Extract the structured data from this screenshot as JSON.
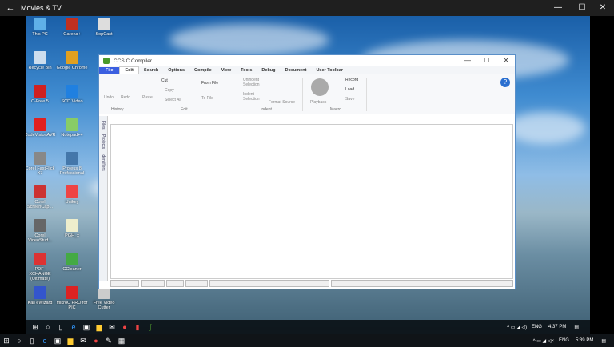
{
  "app": {
    "title": "Movies & TV",
    "back_icon": "arrow-left-icon",
    "min": "—",
    "max": "☐",
    "close": "✕"
  },
  "desktop_icons": [
    {
      "label": "This PC",
      "color": "#5fb0e8"
    },
    {
      "label": "Garena+",
      "color": "#c03020"
    },
    {
      "label": "SopCast",
      "color": "#ddd"
    },
    {
      "label": "Recycle Bin",
      "color": "#cde"
    },
    {
      "label": "Google Chrome",
      "color": "#e0a020"
    },
    {
      "label": "C-Free 5",
      "color": "#d02020"
    },
    {
      "label": "SCD Video",
      "color": "#2080e0"
    },
    {
      "label": "CodeVisionAVR",
      "color": "#e02020"
    },
    {
      "label": "Notepad++",
      "color": "#8c6"
    },
    {
      "label": "Corel FastFlick X7",
      "color": "#888"
    },
    {
      "label": "Proteus 8 Professional",
      "color": "#47a"
    },
    {
      "label": "Corel ScreenCap...",
      "color": "#c33"
    },
    {
      "label": "Unikey",
      "color": "#e44"
    },
    {
      "label": "Corel VideoStud...",
      "color": "#666"
    },
    {
      "label": "PGH_x",
      "color": "#eec"
    },
    {
      "label": "PDF-XCHANGE (Ultimate)",
      "color": "#d33"
    },
    {
      "label": "CCleaner",
      "color": "#4a4"
    },
    {
      "label": "Kali eWizard",
      "color": "#35c"
    },
    {
      "label": "mikroC PRO for PIC",
      "color": "#d22"
    },
    {
      "label": "Free Video Cutter",
      "color": "#ccc"
    }
  ],
  "compiler": {
    "title": "CCS C Compiler",
    "min": "—",
    "max": "☐",
    "close": "✕",
    "menus": [
      "File",
      "Edit",
      "Search",
      "Options",
      "Compile",
      "View",
      "Tools",
      "Debug",
      "Document",
      "User Toolbar"
    ],
    "ribbon": {
      "undo": "Undo",
      "redo": "Redo",
      "history": "History",
      "paste": "Paste",
      "cut": "Cut",
      "copy": "Copy",
      "select_all": "Select All",
      "from_file": "From File",
      "to_file": "To File",
      "edit": "Edit",
      "unindent": "Unindent Selection",
      "indent_sel": "Indent Selection",
      "format_source": "Format Source",
      "indent": "Indent",
      "playback": "Playback",
      "record": "Record",
      "load": "Load",
      "save": "Save",
      "macro": "Macro"
    },
    "side_tabs": [
      "Files",
      "Projects",
      "Identifiers"
    ]
  },
  "taskbar_inner": {
    "lang": "ENG",
    "time": "4:37 PM"
  },
  "taskbar": {
    "lang": "ENG",
    "time": "5:39 PM"
  }
}
